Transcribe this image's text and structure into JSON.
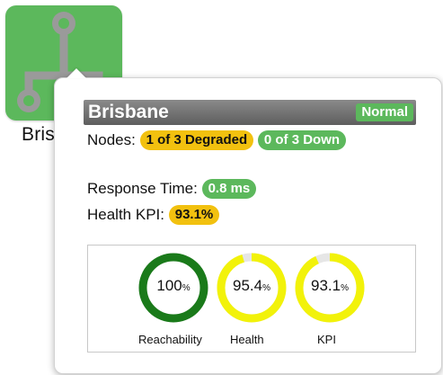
{
  "node": {
    "icon": "network-node-icon",
    "name": "Bris",
    "color": "#5cb85c"
  },
  "popup": {
    "title": "Brisbane",
    "status": "Normal",
    "nodes_label": "Nodes:",
    "nodes_degraded": "1 of 3 Degraded",
    "nodes_down": "0 of 3 Down",
    "response_label": "Response Time:",
    "response_value": "0.8 ms",
    "health_kpi_label": "Health KPI:",
    "health_kpi_value": "93.1%"
  },
  "gauges": [
    {
      "value": "100",
      "unit": "%",
      "label": "Reachability",
      "fraction": 1.0,
      "color": "#1a7a1a"
    },
    {
      "value": "95.4",
      "unit": "%",
      "label": "Health",
      "fraction": 0.954,
      "color": "#f2f20a"
    },
    {
      "value": "93.1",
      "unit": "%",
      "label": "KPI",
      "fraction": 0.931,
      "color": "#f2f20a"
    }
  ],
  "colors": {
    "good": "#5cb85c",
    "warning": "#f2c10f",
    "header": "#6e6e6e"
  }
}
